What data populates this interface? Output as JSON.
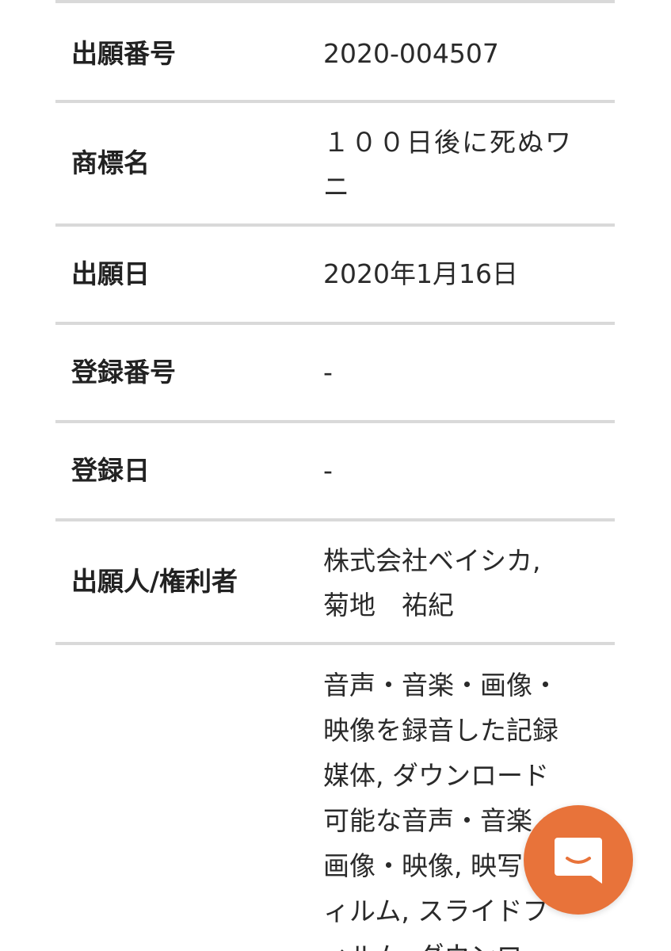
{
  "rows": [
    {
      "label": "出願番号",
      "value": "2020-004507"
    },
    {
      "label": "商標名",
      "value": "１００日後に死ぬワニ"
    },
    {
      "label": "出願日",
      "value": "2020年1月16日"
    },
    {
      "label": "登録番号",
      "value": "-"
    },
    {
      "label": "登録日",
      "value": "-"
    },
    {
      "label": "出願人/権利者",
      "value_lines": [
        "株式会社ベイシカ,",
        "菊地　祐紀"
      ]
    },
    {
      "label": "",
      "value_lines": [
        "音声・音楽・画像・",
        "映像を録音した記録",
        "媒体, ダウンロード",
        "可能な音声・音楽・",
        "画像・映像, 映写フ",
        "ィルム, スライドフ",
        "ィルム, ダウンロー"
      ]
    }
  ],
  "chat": {
    "icon": "chat-bubble-icon",
    "color": "#e8733a"
  }
}
